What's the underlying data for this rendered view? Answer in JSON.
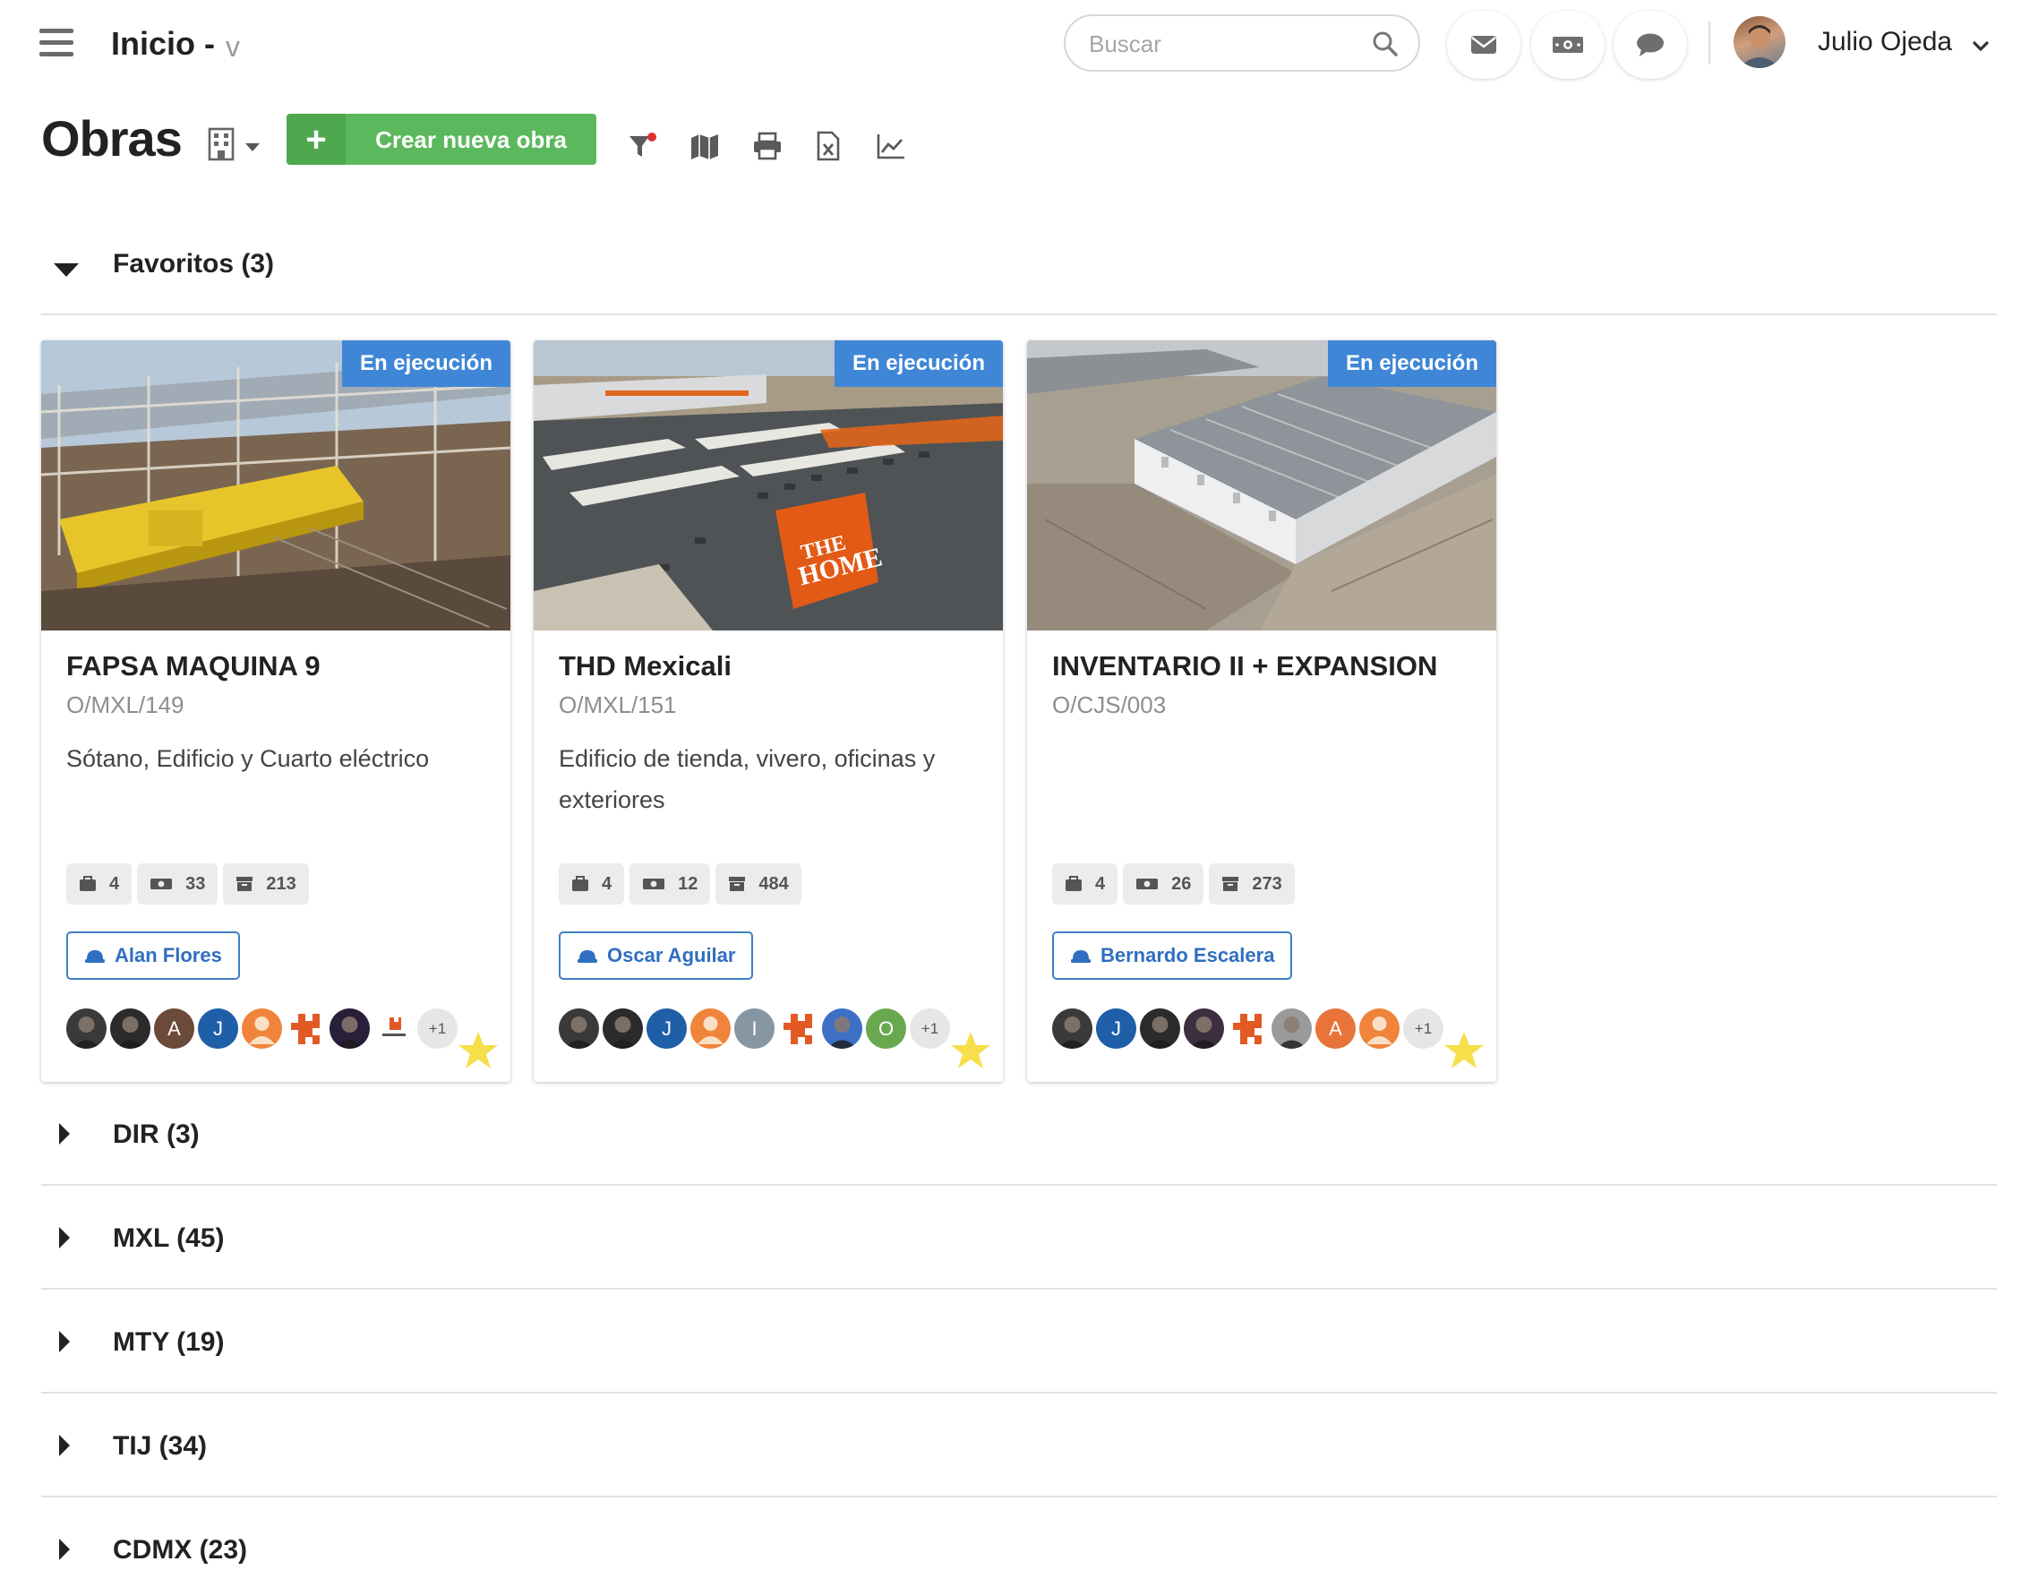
{
  "header": {
    "breadcrumb": "Inicio -",
    "breadcrumb_toggle": "v",
    "search_placeholder": "Buscar",
    "user_name": "Julio Ojeda"
  },
  "page": {
    "title": "Obras",
    "new_button_label": "Crear nueva obra"
  },
  "sections": {
    "favorites": {
      "label": "Favoritos (3)"
    },
    "collapsed": [
      {
        "label": "DIR (3)"
      },
      {
        "label": "MXL (45)"
      },
      {
        "label": "MTY (19)"
      },
      {
        "label": "TIJ (34)"
      },
      {
        "label": "CDMX (23)"
      }
    ]
  },
  "cards": [
    {
      "status": "En ejecución",
      "name": "FAPSA MAQUINA 9",
      "code": "O/MXL/149",
      "description": "Sótano, Edificio y Cuarto eléctrico",
      "stats": [
        "4",
        "33",
        "213"
      ],
      "lead": "Alan Flores",
      "team": [
        {
          "type": "photo",
          "bg": "#3a3a3a"
        },
        {
          "type": "photo",
          "bg": "#2b2b2b"
        },
        {
          "type": "letter",
          "letter": "A",
          "bg": "#6b4a3a"
        },
        {
          "type": "letter",
          "letter": "J",
          "bg": "#1f5fa8"
        },
        {
          "type": "person",
          "bg": "#f0843a"
        },
        {
          "type": "logo",
          "bg": "#ffffff"
        },
        {
          "type": "photo",
          "bg": "#2a1f3a"
        },
        {
          "type": "logo-small",
          "bg": "#ffffff"
        }
      ],
      "team_extra": "+1"
    },
    {
      "status": "En ejecución",
      "name": "THD Mexicali",
      "code": "O/MXL/151",
      "description": "Edificio de tienda, vivero, oficinas y exteriores",
      "stats": [
        "4",
        "12",
        "484"
      ],
      "lead": "Oscar Aguilar",
      "team": [
        {
          "type": "photo",
          "bg": "#3a3a3a"
        },
        {
          "type": "photo",
          "bg": "#2b2b2b"
        },
        {
          "type": "letter",
          "letter": "J",
          "bg": "#1f5fa8"
        },
        {
          "type": "person",
          "bg": "#f0843a"
        },
        {
          "type": "letter",
          "letter": "I",
          "bg": "#8796a3"
        },
        {
          "type": "logo",
          "bg": "#ffffff"
        },
        {
          "type": "photo",
          "bg": "#3d6fc4"
        },
        {
          "type": "letter",
          "letter": "O",
          "bg": "#6aa84f"
        }
      ],
      "team_extra": "+1"
    },
    {
      "status": "En ejecución",
      "name": "INVENTARIO II + EXPANSION",
      "code": "O/CJS/003",
      "description": "",
      "stats": [
        "4",
        "26",
        "273"
      ],
      "lead": "Bernardo Escalera",
      "team": [
        {
          "type": "photo",
          "bg": "#3a3a3a"
        },
        {
          "type": "letter",
          "letter": "J",
          "bg": "#1f5fa8"
        },
        {
          "type": "photo",
          "bg": "#2b2b2b"
        },
        {
          "type": "photo",
          "bg": "#3c2f3f"
        },
        {
          "type": "logo",
          "bg": "#ffffff"
        },
        {
          "type": "photo",
          "bg": "#9a9a9a"
        },
        {
          "type": "letter",
          "letter": "A",
          "bg": "#e8743a"
        },
        {
          "type": "person",
          "bg": "#f0843a"
        }
      ],
      "team_extra": "+1"
    }
  ],
  "colors": {
    "accent_green": "#5cb85c",
    "status_blue": "#3f87d6",
    "lead_blue": "#2f6fbf",
    "filter_dot": "#e03030",
    "star": "#f6df4a"
  },
  "icons": [
    "menu-icon",
    "search-icon",
    "mail-icon",
    "money-icon",
    "chat-icon",
    "chevron-down-icon",
    "building-icon",
    "filter-icon",
    "map-icon",
    "print-icon",
    "excel-icon",
    "chart-icon",
    "caret-down-icon",
    "caret-right-icon",
    "briefcase-icon",
    "cash-icon",
    "archive-icon",
    "hard-hat-icon",
    "star-icon"
  ]
}
